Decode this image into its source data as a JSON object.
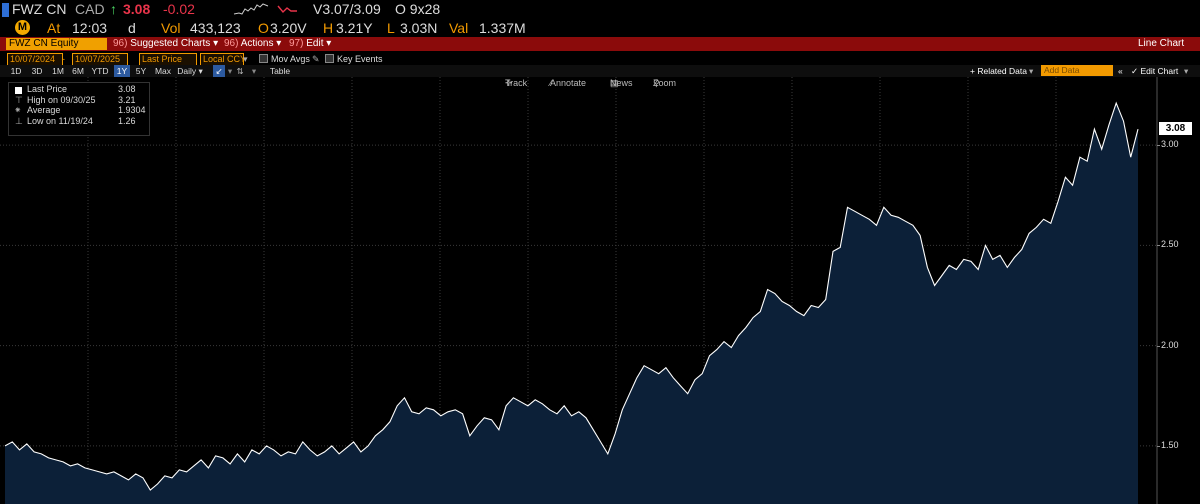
{
  "header": {
    "ticker": "FWZ CN",
    "currency": "CAD",
    "arrow": "↑",
    "last_price": "3.08",
    "change": "-0.02",
    "bid_ask": "V3.07/3.09",
    "size": "O 9x28",
    "at_label": "At",
    "time": "12:03",
    "time_suffix": "d",
    "vol_label": "Vol",
    "vol": "433,123",
    "open_label": "O",
    "open": "3.20V",
    "high_label": "H",
    "high": "3.21Y",
    "low_label": "L",
    "low": "3.03N",
    "val_label": "Val",
    "val": "1.337M",
    "rt_badge": "M"
  },
  "toolbar": {
    "security": "FWZ CN Equity",
    "suggested_tag": "96)",
    "suggested": "Suggested Charts",
    "actions_tag": "96)",
    "actions": "Actions",
    "edit_tag": "97)",
    "edit": "Edit",
    "title": "Line Chart"
  },
  "params": {
    "start_date": "10/07/2024",
    "end_date": "10/07/2025",
    "field": "Last Price",
    "ccy": "Local CCY",
    "mov_avgs": "Mov Avgs",
    "key_events": "Key Events"
  },
  "periods": [
    "1D",
    "3D",
    "1M",
    "6M",
    "YTD",
    "1Y",
    "5Y",
    "Max"
  ],
  "period_active": "1Y",
  "frequency": "Daily",
  "table_label": "Table",
  "related_data": "+ Related Data",
  "add_data": "Add Data",
  "edit_chart": "Edit Chart",
  "trackbar": {
    "track": "Track",
    "annotate": "Annotate",
    "news": "News",
    "zoom": "Zoom"
  },
  "legend": {
    "last_label": "Last Price",
    "last_value": "3.08",
    "high_label": "High on 09/30/25",
    "high_value": "3.21",
    "avg_label": "Average",
    "avg_value": "1.9304",
    "low_label": "Low on 11/19/24",
    "low_value": "1.26"
  },
  "colors": {
    "line": "#ffffff",
    "area": "#0c2038",
    "toolbar": "#8b0b0b",
    "accent": "#f29a00",
    "price_up": "#4cd964",
    "price": "#e8344a"
  },
  "chart_data": {
    "type": "area",
    "series": [
      {
        "name": "Last Price",
        "values": [
          1.5,
          1.52,
          1.48,
          1.51,
          1.47,
          1.46,
          1.44,
          1.43,
          1.42,
          1.4,
          1.41,
          1.39,
          1.38,
          1.37,
          1.36,
          1.37,
          1.35,
          1.33,
          1.36,
          1.34,
          1.28,
          1.31,
          1.35,
          1.34,
          1.38,
          1.37,
          1.4,
          1.43,
          1.39,
          1.45,
          1.44,
          1.41,
          1.46,
          1.42,
          1.48,
          1.46,
          1.5,
          1.48,
          1.45,
          1.47,
          1.46,
          1.52,
          1.48,
          1.45,
          1.47,
          1.5,
          1.46,
          1.49,
          1.52,
          1.47,
          1.5,
          1.55,
          1.58,
          1.62,
          1.7,
          1.74,
          1.67,
          1.66,
          1.69,
          1.68,
          1.65,
          1.67,
          1.68,
          1.66,
          1.55,
          1.6,
          1.64,
          1.63,
          1.58,
          1.7,
          1.74,
          1.72,
          1.7,
          1.73,
          1.71,
          1.68,
          1.66,
          1.7,
          1.65,
          1.67,
          1.64,
          1.58,
          1.52,
          1.46,
          1.56,
          1.68,
          1.76,
          1.84,
          1.9,
          1.88,
          1.86,
          1.89,
          1.84,
          1.8,
          1.76,
          1.83,
          1.86,
          1.95,
          1.98,
          2.02,
          1.99,
          2.05,
          2.09,
          2.14,
          2.17,
          2.28,
          2.26,
          2.22,
          2.2,
          2.17,
          2.15,
          2.2,
          2.19,
          2.23,
          2.47,
          2.49,
          2.69,
          2.67,
          2.65,
          2.63,
          2.6,
          2.69,
          2.65,
          2.64,
          2.62,
          2.6,
          2.55,
          2.39,
          2.3,
          2.35,
          2.4,
          2.38,
          2.43,
          2.42,
          2.38,
          2.5,
          2.43,
          2.45,
          2.39,
          2.44,
          2.48,
          2.56,
          2.59,
          2.63,
          2.61,
          2.72,
          2.84,
          2.8,
          2.94,
          2.92,
          3.08,
          2.98,
          3.1,
          3.21,
          3.12,
          2.94,
          3.08
        ]
      }
    ],
    "x_start": "10/07/2024",
    "x_end": "10/07/2025",
    "y_ticks": [
      "1.50",
      "2.00",
      "2.50",
      "3.00"
    ],
    "ylim": [
      1.21,
      3.34
    ],
    "last_label": "3.08",
    "grid": true
  }
}
